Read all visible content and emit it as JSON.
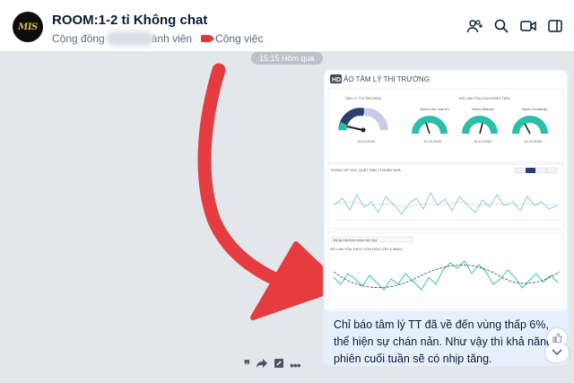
{
  "header": {
    "avatar_text": "MIS",
    "title": "ROOM:1-2 tỉ Không chat",
    "community_label": "Cộng đồng",
    "members_label": "ành viên",
    "tag_label": "Công việc",
    "icons": [
      "add-member-icon",
      "search-icon",
      "video-call-icon",
      "sidebar-toggle-icon"
    ]
  },
  "chat": {
    "time_label": "15:15 Hôm qua",
    "message": {
      "image": {
        "hd_badge": "HD",
        "report_title": "ẢO TÂM LÝ THỊ TRƯỜNG",
        "gauge_market_title": "TÂM LÝ THỊ TRƯỜNG",
        "gauge_market_date": "19.10.2024",
        "cashflow_title": "ĐỘ LAN TỎA CỦA DÒNG TIỀN",
        "gauges": [
          {
            "label": "Nhóm vốn hóa lớn",
            "date": "19.10.2024"
          },
          {
            "label": "Nhóm Midcap",
            "date": "19.10.2024"
          },
          {
            "label": "Nhóm Smallcap",
            "date": "19.10.2024"
          }
        ],
        "chart1_title": "THỐNG KÊ SỐC QUẤT BẢN TÍ NHÂN NHÀ",
        "chart1_tabs": [
          "1M",
          "3M",
          "6M",
          "1Y"
        ],
        "chart2_select": "Độ lan tỏa theo nhóm vốn hóa",
        "chart2_title": "ĐỘ LAN TỎA THEO VỐN HÓA LỚN & MA20"
      },
      "text": "Chỉ báo tâm lý TT đã về đến vùng thấp 6%, thể hiện sự chán nản. Như vậy thì khả năng 2 phiên cuối tuần sẽ có nhịp tăng."
    },
    "actions": [
      "quote-icon",
      "share-icon",
      "edit-icon",
      "more-icon"
    ]
  },
  "colors": {
    "accent_red": "#e0373d",
    "bubble_bg": "#e6f0fd",
    "arrow_red": "#e53d3f",
    "gauge_teal": "#2bbfa8"
  }
}
